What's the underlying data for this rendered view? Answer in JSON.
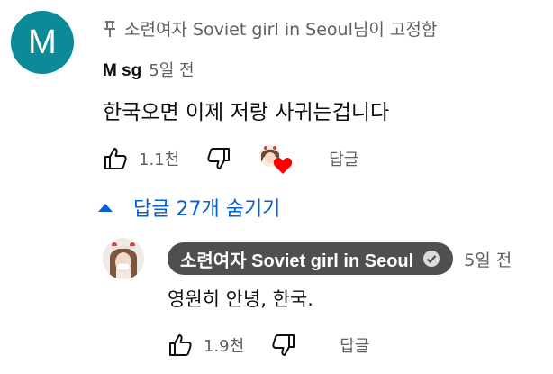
{
  "pinned_comment": {
    "avatar_letter": "M",
    "pinned_label": "소련여자 Soviet girl in Seoul님이 고정함",
    "author": "M sg",
    "time": "5일 전",
    "text": "한국오면 이제 저랑 사귀는겁니다",
    "like_count": "1.1천",
    "reply_label": "답글",
    "creator_heart": true
  },
  "replies_toggle": {
    "label": "답글 27개 숨기기"
  },
  "reply": {
    "channel_name": "소련여자 Soviet girl in Seoul",
    "time": "5일 전",
    "text": "영원히 안녕, 한국.",
    "like_count": "1.9천",
    "reply_label": "답글"
  },
  "colors": {
    "avatar_bg": "#0b8a98",
    "link_blue": "#065fd4",
    "owner_badge_bg": "#4f4f4f",
    "heart_red": "#ff0000"
  }
}
